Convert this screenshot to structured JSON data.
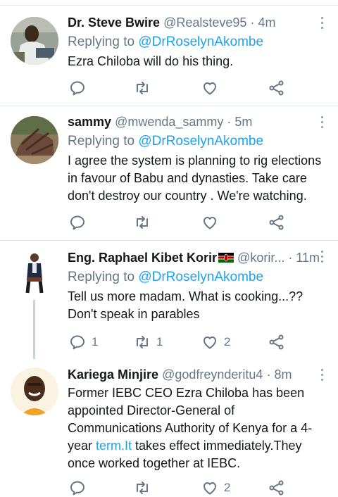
{
  "tweets": [
    {
      "name": "Dr. Steve Bwire",
      "handle": "@Realsteve95",
      "separator": "·",
      "time": "4m",
      "replying_prefix": "Replying to",
      "replying_to": "@DrRoselynAkombe",
      "text": "Ezra Chiloba will do his thing.",
      "reply_count": "",
      "retweet_count": "",
      "like_count": ""
    },
    {
      "name": "sammy",
      "handle": "@mwenda_sammy",
      "separator": "·",
      "time": "5m",
      "replying_prefix": "Replying to",
      "replying_to": "@DrRoselynAkombe",
      "text": "I agree the system is planning to rig elections in favour of Babu and dynasties. Take care don't destroy our country . We're watching.",
      "reply_count": "",
      "retweet_count": "",
      "like_count": ""
    },
    {
      "name": "Eng. Raphael Kibet Korir",
      "handle": "@korir...",
      "separator": "·",
      "time": "11m",
      "replying_prefix": "Replying to",
      "replying_to": "@DrRoselynAkombe",
      "text_line1": "Tell us more madam. What is cooking...??",
      "text_line2": "Don't speak in parables",
      "reply_count": "1",
      "retweet_count": "1",
      "like_count": "2"
    },
    {
      "name": "Kariega Minjire",
      "handle": "@godfreynderitu4",
      "separator": "·",
      "time": "8m",
      "text_before_link": "Former IEBC CEO Ezra Chiloba has been appointed Director-General of Communications Authority of Kenya for a 4-year ",
      "link_text": "term.It",
      "text_after_link": " takes effect immediately.They once worked together at IEBC.",
      "like_count": "2"
    }
  ],
  "icons": {
    "reply": "reply-icon",
    "retweet": "retweet-icon",
    "like": "heart-icon",
    "share": "share-icon",
    "more": "caret-icon",
    "flag": "kenya-flag-emoji"
  },
  "colors": {
    "link": "#1da1f2",
    "secondary_text": "#657786",
    "icon": "#657786",
    "divider": "#e1e8ed"
  }
}
